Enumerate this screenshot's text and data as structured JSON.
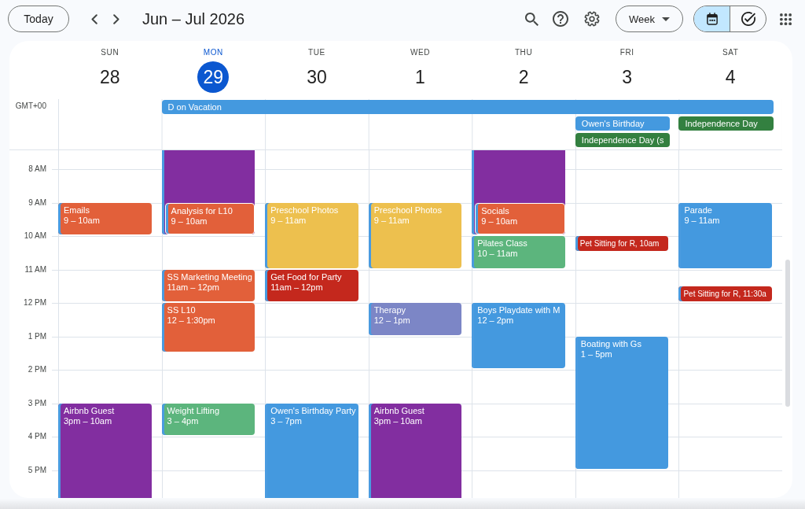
{
  "toolbar": {
    "today_button": "Today",
    "title": "Jun – Jul 2026",
    "view_menu": "Week",
    "view_toggle": [
      {
        "kind": "calendar",
        "selected": true
      },
      {
        "kind": "tasks",
        "selected": false
      }
    ]
  },
  "timezone": "GMT+00",
  "hours": [
    "8 AM",
    "9 AM",
    "10 AM",
    "11 AM",
    "12 PM",
    "1 PM",
    "2 PM",
    "3 PM",
    "4 PM",
    "5 PM"
  ],
  "days": [
    {
      "weekday": "SUN",
      "date": "28",
      "selected": false,
      "events": [
        {
          "kind": "timed",
          "title": "Emails",
          "time": "9 – 10am",
          "color": "#e2603a"
        },
        {
          "kind": "timed",
          "title": "Airbnb Guest",
          "time": "3pm – 10am",
          "color": "#822ea0"
        }
      ]
    },
    {
      "weekday": "MON",
      "date": "29",
      "selected": true,
      "all_day": [
        {
          "title": "D on Vacation",
          "color": "#4499df"
        }
      ],
      "events": [
        {
          "kind": "continued",
          "color": "#822ea0"
        },
        {
          "kind": "timed",
          "title": "Analysis for L10",
          "time": "9 – 10am",
          "color": "#e2603a"
        },
        {
          "kind": "timed",
          "title": "SS Marketing Meeting",
          "time": "11am – 12pm",
          "color": "#e2603a"
        },
        {
          "kind": "timed",
          "title": "SS L10",
          "time": "12 – 1:30pm",
          "color": "#e2603a"
        },
        {
          "kind": "timed",
          "title": "Weight Lifting",
          "time": "3 – 4pm",
          "color": "#5cb57d"
        }
      ]
    },
    {
      "weekday": "TUE",
      "date": "30",
      "selected": false,
      "events": [
        {
          "kind": "timed",
          "title": "Preschool Photos",
          "time": "9 – 11am",
          "color": "#edc04e"
        },
        {
          "kind": "timed",
          "title": "Get Food for Party",
          "time": "11am – 12pm",
          "color": "#c4281d"
        },
        {
          "kind": "timed",
          "title": "Owen's Birthday Party",
          "time": "3 – 7pm",
          "color": "#4499df"
        }
      ]
    },
    {
      "weekday": "WED",
      "date": "1",
      "selected": false,
      "events": [
        {
          "kind": "timed",
          "title": "Preschool Photos",
          "time": "9 – 11am",
          "color": "#edc04e"
        },
        {
          "kind": "timed",
          "title": "Therapy",
          "time": "12 – 1pm",
          "color": "#7c86c6"
        },
        {
          "kind": "timed",
          "title": "Airbnb Guest",
          "time": "3pm – 10am",
          "color": "#822ea0"
        }
      ]
    },
    {
      "weekday": "THU",
      "date": "2",
      "selected": false,
      "events": [
        {
          "kind": "continued",
          "color": "#822ea0"
        },
        {
          "kind": "timed",
          "title": "Socials",
          "time": "9 – 10am",
          "color": "#e2603a"
        },
        {
          "kind": "timed",
          "title": "Pilates Class",
          "time": "10 – 11am",
          "color": "#5cb57d"
        },
        {
          "kind": "timed",
          "title": "Boys Playdate with M",
          "time": "12 – 2pm",
          "color": "#4499df"
        }
      ]
    },
    {
      "weekday": "FRI",
      "date": "3",
      "selected": false,
      "all_day": [
        {
          "title": "Owen's Birthday",
          "color": "#4499df"
        },
        {
          "title": "Independence Day (s",
          "color": "#338040"
        }
      ],
      "events": [
        {
          "kind": "compact",
          "title": "Pet Sitting for R, 10am",
          "color": "#c4281d"
        },
        {
          "kind": "timed",
          "title": "Boating with Gs",
          "time": "1 – 5pm",
          "color": "#4499df"
        }
      ]
    },
    {
      "weekday": "SAT",
      "date": "4",
      "selected": false,
      "all_day": [
        {
          "title": "Independence Day",
          "color": "#338040"
        }
      ],
      "events": [
        {
          "kind": "timed",
          "title": "Parade",
          "time": "9 – 11am",
          "color": "#4499df"
        },
        {
          "kind": "compact",
          "title": "Pet Sitting for R, 11:30a",
          "color": "#c4281d"
        }
      ]
    }
  ]
}
